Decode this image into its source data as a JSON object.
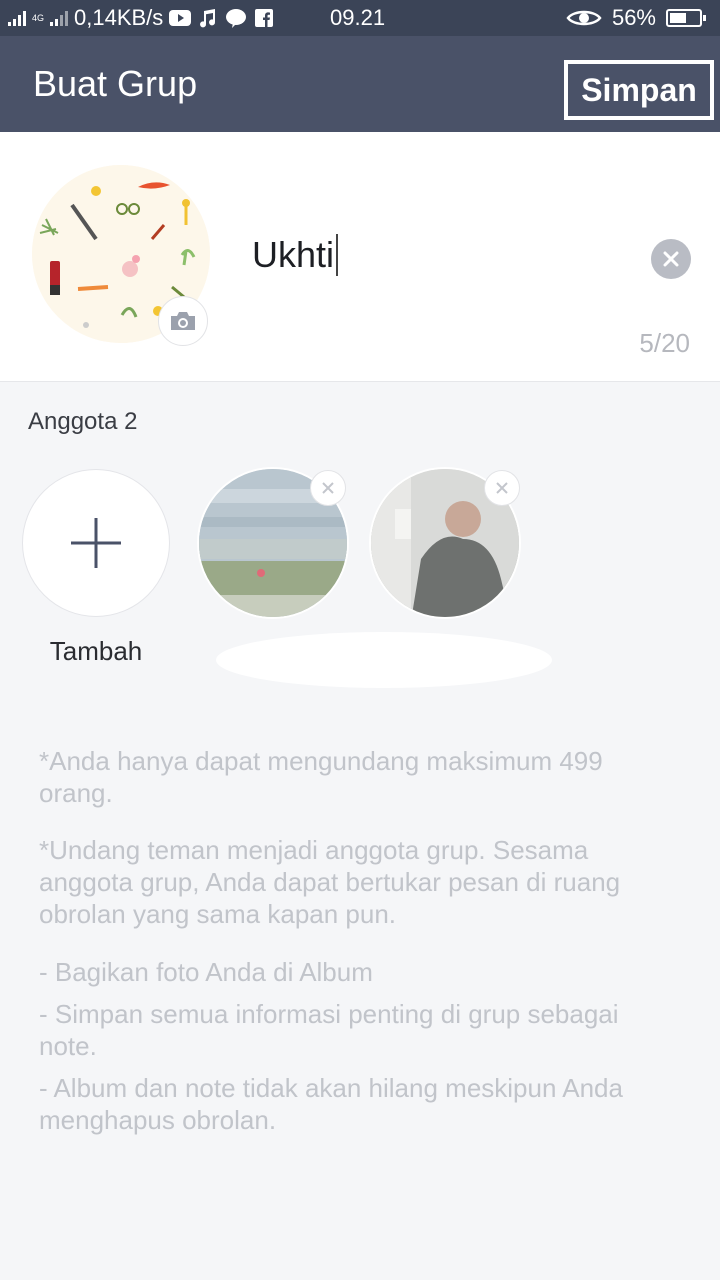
{
  "status_bar": {
    "network": "4G",
    "speed": "0,14KB/s",
    "time": "09.21",
    "battery": "56%",
    "battery_level": 0.56,
    "icons": [
      "youtube-icon",
      "music-icon",
      "line-icon",
      "facebook-icon",
      "eye-icon"
    ]
  },
  "header": {
    "title": "Buat Grup",
    "save_label": "Simpan"
  },
  "group": {
    "name_value": "Ukhti",
    "char_count": "5/20"
  },
  "members": {
    "label": "Anggota 2",
    "add_label": "Tambah"
  },
  "info": {
    "line1": "*Anda hanya dapat mengundang maksimum 499 orang.",
    "line2": "*Undang teman menjadi anggota grup. Sesama anggota grup, Anda dapat bertukar pesan di ruang obrolan yang sama kapan pun.",
    "line3": "- Bagikan foto Anda di Album",
    "line4": "- Simpan semua informasi penting di grup sebagai note.",
    "line5": "- Album dan note tidak akan hilang meskipun Anda menghapus obrolan."
  },
  "colors": {
    "status_bar": "#3b4457",
    "app_bar": "#4a5268",
    "background": "#f5f6f8",
    "muted_text": "#c1c4ca"
  }
}
